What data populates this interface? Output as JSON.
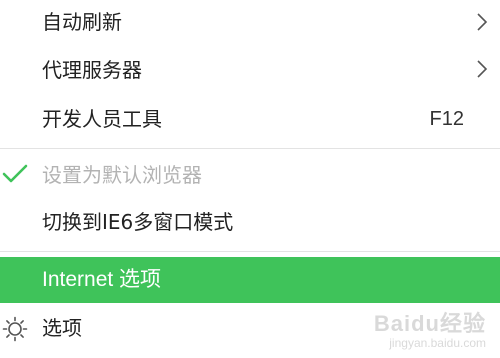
{
  "menu": {
    "items": [
      {
        "label": "自动刷新",
        "submenu_icon": "chevron-right-icon"
      },
      {
        "label": "代理服务器",
        "submenu_icon": "chevron-right-icon"
      },
      {
        "label": "开发人员工具",
        "shortcut": "F12"
      },
      {
        "label": "设置为默认浏览器",
        "state": "checked-disabled",
        "icon": "checkmark-icon"
      },
      {
        "label": "切换到IE6多窗口模式"
      },
      {
        "label": "Internet 选项",
        "state": "highlighted"
      },
      {
        "label": "选项",
        "icon": "gear-icon"
      }
    ]
  },
  "colors": {
    "highlight": "#3fc35a",
    "checkmark": "#3fc35a",
    "disabled_text": "#b3b3b3"
  },
  "watermark": {
    "text": "Baidu经验",
    "sub": "jingyan.baidu.com"
  }
}
